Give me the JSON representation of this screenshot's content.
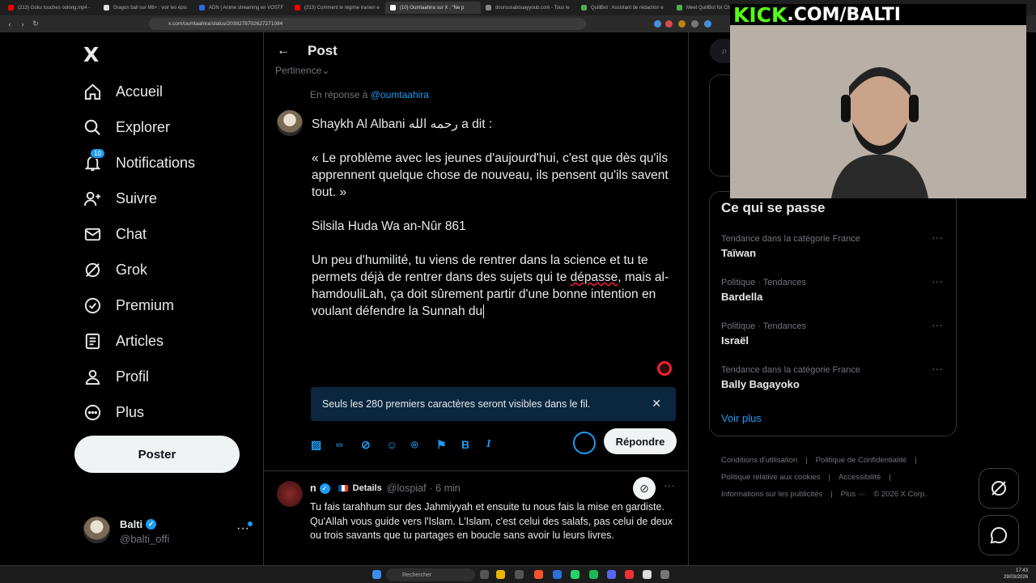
{
  "browser": {
    "tabs": [
      {
        "label": "(213) Goku touches oolong.mp4 - ",
        "color": "#ff0000",
        "active": false
      },
      {
        "label": "Dragon ball sur M6+ : voir les épis",
        "color": "#e0e0e0",
        "active": false
      },
      {
        "label": "ADN | Anime streaming en VOSTF",
        "color": "#2a6ae0",
        "active": false
      },
      {
        "label": "(213) Comment le régime iranien e",
        "color": "#ff0000",
        "active": false
      },
      {
        "label": "(10) Oumtaahira sur X : \"Ne p",
        "color": "#ffffff",
        "active": true
      },
      {
        "label": "dourousabouayyoub.com - Tous le",
        "color": "#888888",
        "active": false
      },
      {
        "label": "QuillBot : Assistant de rédaction e",
        "color": "#4caf50",
        "active": false
      },
      {
        "label": "Meet QuillBot for Chr",
        "color": "#4caf50",
        "active": false
      }
    ],
    "url": "x.com/oumtaahira/status/2038278702627271084"
  },
  "sidebar": {
    "logo": "X",
    "items": [
      {
        "label": "Accueil",
        "icon": "home-icon"
      },
      {
        "label": "Explorer",
        "icon": "search-icon"
      },
      {
        "label": "Notifications",
        "icon": "bell-icon",
        "badge": "10"
      },
      {
        "label": "Suivre",
        "icon": "follow-icon"
      },
      {
        "label": "Chat",
        "icon": "mail-icon"
      },
      {
        "label": "Grok",
        "icon": "grok-icon"
      },
      {
        "label": "Premium",
        "icon": "verified-icon"
      },
      {
        "label": "Articles",
        "icon": "articles-icon"
      },
      {
        "label": "Profil",
        "icon": "profile-icon"
      },
      {
        "label": "Plus",
        "icon": "more-circle-icon"
      }
    ],
    "post_button": "Poster",
    "account": {
      "name": "Balti",
      "handle": "@balti_offi"
    }
  },
  "main": {
    "header_title": "Post",
    "sort_label": "Pertinence",
    "reply_to_prefix": "En réponse à",
    "reply_to_handle": "@oumtaahira",
    "compose": {
      "line1": "Shaykh Al Albani رحمه الله a dit :",
      "quote": "« Le problème avec les jeunes d'aujourd'hui, c'est que dès qu'ils apprennent quelque chose de nouveau, ils pensent qu'ils savent tout. »",
      "source": "Silsila Huda Wa an-Nûr 861",
      "comment_a": "Un peu d'humilité, tu viens de rentrer dans la science et tu te permets déjà de rentrer dans des sujets qui te",
      "comment_underlined": "dépasse",
      "comment_b": ", mais al-hamdouliLah, ça doit sûrement partir d'une bonne intention en voulant défendre la Sunnah du"
    },
    "notice": "Seuls les 280 premiers caractères seront visibles dans le fil.",
    "toolbar_icons": [
      "image-icon",
      "gif-icon",
      "grok-icon",
      "emoji-icon",
      "location-icon",
      "flag-icon",
      "bold-icon",
      "italic-icon"
    ],
    "reply_button": "Répondre",
    "reply_post": {
      "name": "n",
      "details_label": "Details",
      "handle": "@lospiaf",
      "time": "· 6 min",
      "text": "Tu fais tarahhum sur des Jahmiyyah et ensuite tu nous fais la mise en gardiste. Qu'Allah vous guide vers l'Islam. L'Islam, c'est celui des salafs, pas celui de deux ou trois savants que tu partages en boucle sans avoir lu leurs livres."
    }
  },
  "right": {
    "trends_title": "Ce qui se passe",
    "trends": [
      {
        "context": "Tendance dans la catégorie France",
        "name": "Taïwan"
      },
      {
        "context": "Politique · Tendances",
        "name": "Bardella"
      },
      {
        "context": "Politique · Tendances",
        "name": "Israël"
      },
      {
        "context": "Tendance dans la catégorie France",
        "name": "Bally Bagayoko"
      }
    ],
    "see_more": "Voir plus",
    "footer_links": [
      "Conditions d'utilisation",
      "|",
      "Politique de Confidentialité",
      "|",
      "Politique relative aux cookies",
      "|",
      "Accessibilité",
      "|",
      "Informations sur les publicités",
      "|",
      "Plus ···",
      "© 2026 X Corp."
    ]
  },
  "overlay": {
    "kick_a": "KICK",
    "kick_b": ".COM/BALTI"
  },
  "taskbar": {
    "search_placeholder": "Rechercher",
    "time": "17:43",
    "date": "29/03/2026"
  }
}
